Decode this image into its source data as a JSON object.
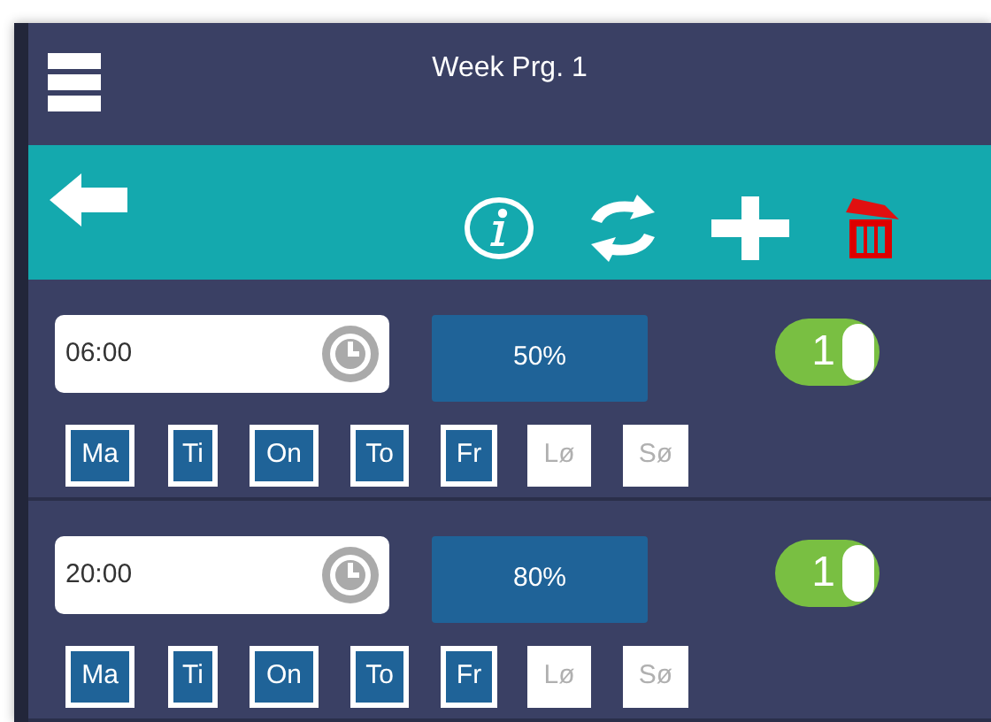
{
  "header": {
    "title": "Week Prg. 1"
  },
  "programs": [
    {
      "time": "06:00",
      "power": "50%",
      "toggle": {
        "label": "1",
        "on": true
      },
      "days": [
        {
          "label": "Ma",
          "selected": true
        },
        {
          "label": "Ti",
          "selected": true
        },
        {
          "label": "On",
          "selected": true
        },
        {
          "label": "To",
          "selected": true
        },
        {
          "label": "Fr",
          "selected": true
        },
        {
          "label": "Lø",
          "selected": false
        },
        {
          "label": "Sø",
          "selected": false
        }
      ]
    },
    {
      "time": "20:00",
      "power": "80%",
      "toggle": {
        "label": "1",
        "on": true
      },
      "days": [
        {
          "label": "Ma",
          "selected": true
        },
        {
          "label": "Ti",
          "selected": true
        },
        {
          "label": "On",
          "selected": true
        },
        {
          "label": "To",
          "selected": true
        },
        {
          "label": "Fr",
          "selected": true
        },
        {
          "label": "Lø",
          "selected": false
        },
        {
          "label": "Sø",
          "selected": false
        }
      ]
    }
  ]
}
